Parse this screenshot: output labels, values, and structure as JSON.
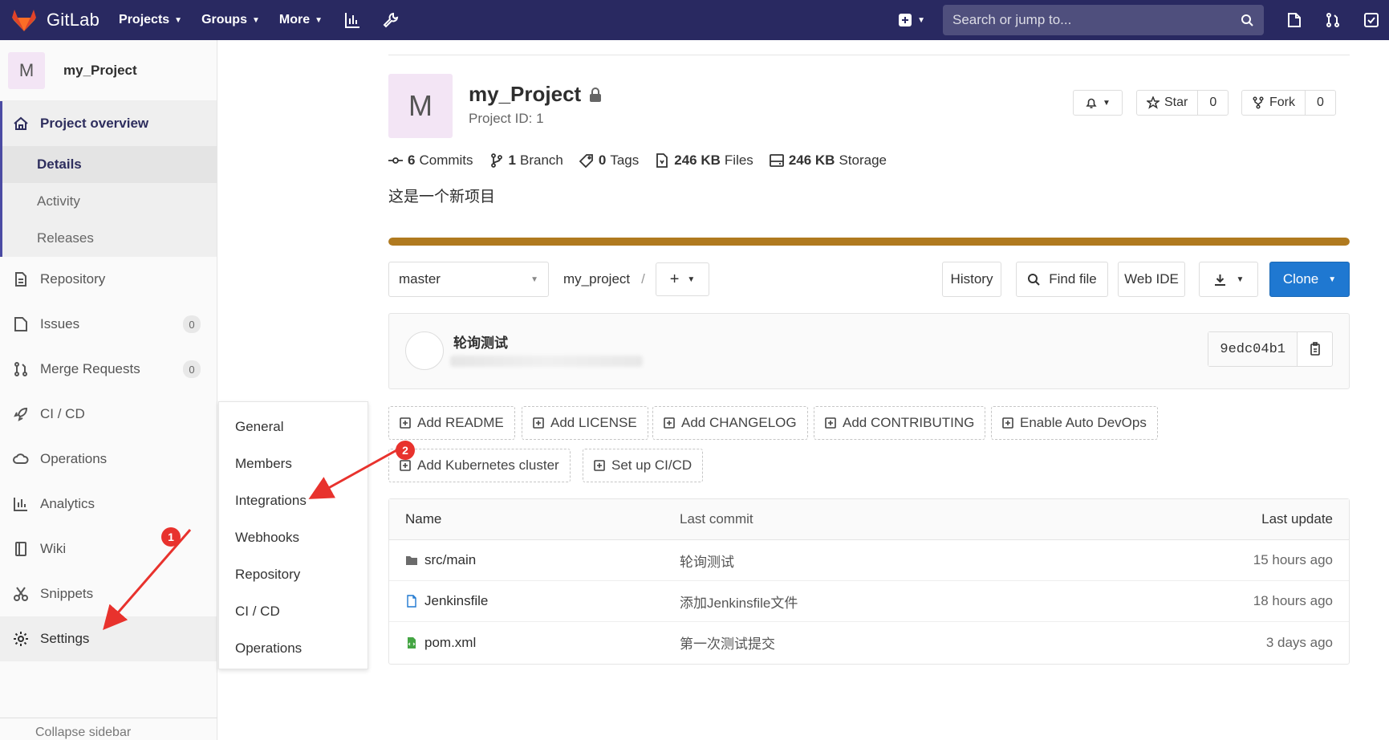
{
  "navbar": {
    "brand": "GitLab",
    "links": [
      {
        "label": "Projects"
      },
      {
        "label": "Groups"
      },
      {
        "label": "More"
      }
    ],
    "search_placeholder": "Search or jump to..."
  },
  "sidebar": {
    "project_initial": "M",
    "project_name": "my_Project",
    "overview": "Project overview",
    "overview_sub": [
      "Details",
      "Activity",
      "Releases"
    ],
    "repository": "Repository",
    "issues": "Issues",
    "issues_count": "0",
    "merge_requests": "Merge Requests",
    "mr_count": "0",
    "cicd": "CI / CD",
    "operations": "Operations",
    "analytics": "Analytics",
    "wiki": "Wiki",
    "snippets": "Snippets",
    "settings": "Settings",
    "collapse": "Collapse sidebar"
  },
  "flyout": {
    "items": [
      "General",
      "Members",
      "Integrations",
      "Webhooks",
      "Repository",
      "CI / CD",
      "Operations"
    ]
  },
  "project": {
    "initial": "M",
    "title": "my_Project",
    "id_label": "Project ID: 1",
    "star_label": "Star",
    "star_count": "0",
    "fork_label": "Fork",
    "fork_count": "0",
    "commits_count": "6",
    "commits_label": "Commits",
    "branch_count": "1",
    "branch_label": "Branch",
    "tags_count": "0",
    "tags_label": "Tags",
    "files_size": "246 KB",
    "files_label": "Files",
    "storage_size": "246 KB",
    "storage_label": "Storage",
    "description": "这是一个新项目",
    "language_bar_fill": 1.0,
    "language_color": "#b07a1f"
  },
  "tree": {
    "branch": "master",
    "path": "my_project",
    "separator": "/",
    "history": "History",
    "find_file": "Find file",
    "web_ide": "Web IDE",
    "clone": "Clone"
  },
  "commit": {
    "title": "轮询测试",
    "sha": "9edc04b1"
  },
  "suggestions": [
    "Add README",
    "Add LICENSE",
    "Add CHANGELOG",
    "Add CONTRIBUTING",
    "Enable Auto DevOps",
    "Add Kubernetes cluster",
    "Set up CI/CD"
  ],
  "files": {
    "headers": {
      "name": "Name",
      "last_commit": "Last commit",
      "last_update": "Last update"
    },
    "rows": [
      {
        "name": "src/main",
        "commit": "轮询测试",
        "updated": "15 hours ago",
        "icon": "folder-icon"
      },
      {
        "name": "Jenkinsfile",
        "commit": "添加Jenkinsfile文件",
        "updated": "18 hours ago",
        "icon": "file-icon"
      },
      {
        "name": "pom.xml",
        "commit": "第一次测试提交",
        "updated": "3 days ago",
        "icon": "xml-file-icon"
      }
    ]
  },
  "annotations": {
    "marker1": "1",
    "marker2": "2",
    "color": "#e8322d"
  }
}
